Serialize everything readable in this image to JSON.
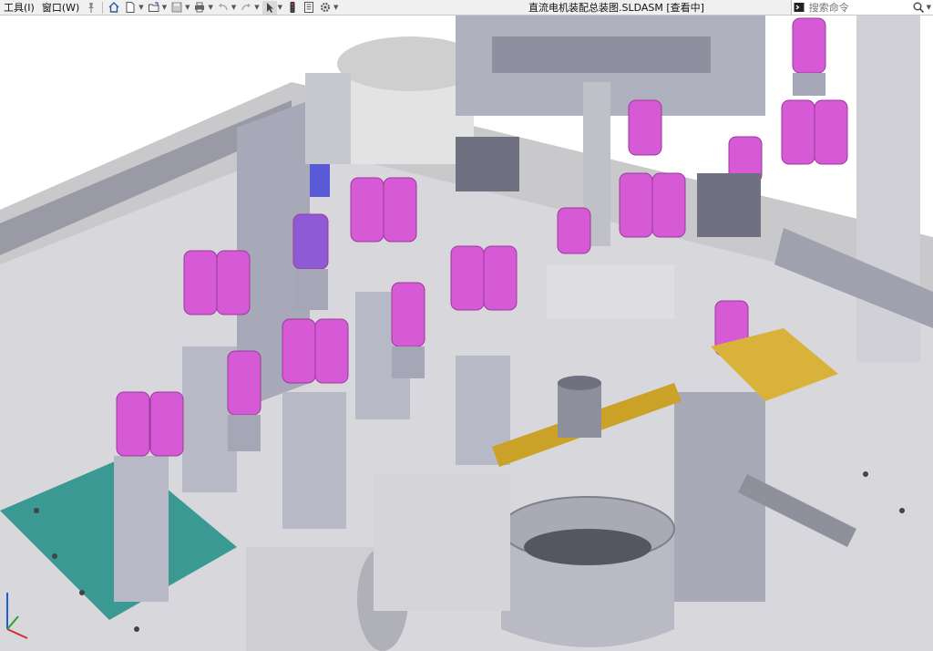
{
  "menu": {
    "tools": "工具(I)",
    "window": "窗口(W)"
  },
  "document": {
    "title": "直流电机装配总装图.SLDASM [查看中]"
  },
  "search": {
    "placeholder": "搜索命令"
  },
  "colors": {
    "part_magenta": "#d65ad6",
    "part_gray": "#b7b8c4",
    "frame_light": "#dcdcdc",
    "brass": "#c9a227",
    "teal": "#1f8f86"
  },
  "icons": [
    "pin-icon",
    "home-icon",
    "new-document-icon",
    "open-folder-icon",
    "save-icon",
    "print-icon",
    "undo-icon",
    "redo-icon",
    "select-arrow-icon",
    "traffic-light-icon",
    "file-properties-icon",
    "gear-icon",
    "search-icon",
    "help-icon"
  ]
}
